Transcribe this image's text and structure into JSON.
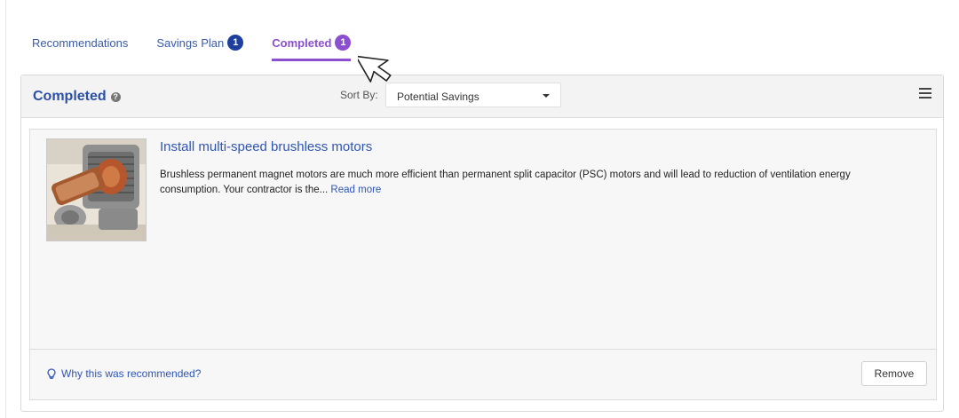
{
  "tabs": [
    {
      "label": "Recommendations",
      "badge": null
    },
    {
      "label": "Savings Plan",
      "badge": "1"
    },
    {
      "label": "Completed",
      "badge": "1"
    }
  ],
  "panel": {
    "title": "Completed",
    "sort_label": "Sort By:",
    "sort_value": "Potential Savings"
  },
  "card": {
    "title": "Install multi-speed brushless motors",
    "description": "Brushless permanent magnet motors are much more efficient than permanent split capacitor (PSC) motors and will lead to reduction of ventilation energy consumption. Your contractor is the...",
    "read_more": "Read more",
    "why_link": "Why this was recommended?",
    "remove_label": "Remove"
  },
  "colors": {
    "tab_link": "#3b5ba9",
    "tab_active": "#8b4fd0",
    "badge_blue": "#1f3f9e",
    "title_blue": "#2c4fa8"
  }
}
